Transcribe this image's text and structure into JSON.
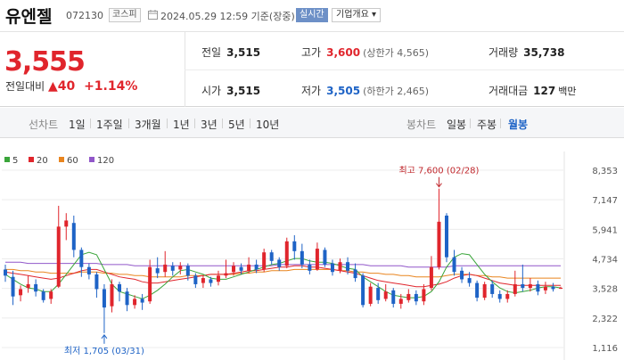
{
  "header": {
    "name": "유엔젤",
    "code": "072130",
    "market": "코스피",
    "datetime": "2024.05.29 12:59 기준(장중)",
    "realtime_label": "실시간",
    "company_label": "기업개요 ▾"
  },
  "summary": {
    "price": "3,555",
    "change_label": "전일대비",
    "change_value": "▲40",
    "change_pct": "+1.14%",
    "cells": {
      "prev_label": "전일",
      "prev_value": "3,515",
      "open_label": "시가",
      "open_value": "3,515",
      "high_label": "고가",
      "high_value": "3,600",
      "high_sub": "(상한가 4,565)",
      "low_label": "저가",
      "low_value": "3,505",
      "low_sub": "(하한가 2,465)",
      "volume_label": "거래량",
      "volume_value": "35,738",
      "amount_label": "거래대금",
      "amount_value": "127",
      "amount_unit": "백만"
    }
  },
  "periods": {
    "line_label": "선차트",
    "line_items": [
      "1일",
      "1주일",
      "3개월",
      "1년",
      "3년",
      "5년",
      "10년"
    ],
    "candle_label": "봉차트",
    "candle_items": [
      "일봉",
      "주봉",
      "월봉"
    ],
    "active": "월봉"
  },
  "colors": {
    "up": "#e0252c",
    "down": "#1e63c6",
    "ma5": "#3aa53a",
    "ma20": "#e0252c",
    "ma60": "#e9851f",
    "ma120": "#9157c9"
  },
  "chart_data": {
    "type": "candlestick",
    "legend": [
      {
        "name": "5",
        "color": "#3aa53a"
      },
      {
        "name": "20",
        "color": "#e0252c"
      },
      {
        "name": "60",
        "color": "#e9851f"
      },
      {
        "name": "120",
        "color": "#9157c9"
      }
    ],
    "y_ticks": [
      8353,
      7147,
      5941,
      4734,
      3528,
      2322,
      1116
    ],
    "ylim": [
      1116,
      8353
    ],
    "annotations": {
      "high": "최고 7,600 (02/28)",
      "low": "최저 1,705 (03/31)"
    },
    "candles": [
      {
        "o": 4300,
        "c": 4050,
        "h": 4500,
        "l": 3800
      },
      {
        "o": 4000,
        "c": 3200,
        "h": 4250,
        "l": 2850
      },
      {
        "o": 3250,
        "c": 3500,
        "h": 3650,
        "l": 3000
      },
      {
        "o": 3550,
        "c": 3700,
        "h": 4050,
        "l": 3350
      },
      {
        "o": 3700,
        "c": 3400,
        "h": 3900,
        "l": 3200
      },
      {
        "o": 3400,
        "c": 3050,
        "h": 3500,
        "l": 2950
      },
      {
        "o": 3100,
        "c": 3400,
        "h": 3500,
        "l": 2900
      },
      {
        "o": 3600,
        "c": 6050,
        "h": 6900,
        "l": 3550
      },
      {
        "o": 6050,
        "c": 6300,
        "h": 6600,
        "l": 5500
      },
      {
        "o": 6200,
        "c": 5100,
        "h": 6500,
        "l": 4800
      },
      {
        "o": 5100,
        "c": 4400,
        "h": 5200,
        "l": 4000
      },
      {
        "o": 4400,
        "c": 4100,
        "h": 4550,
        "l": 3900
      },
      {
        "o": 4100,
        "c": 3500,
        "h": 4200,
        "l": 3150
      },
      {
        "o": 3500,
        "c": 2750,
        "h": 3700,
        "l": 1705
      },
      {
        "o": 2800,
        "c": 3700,
        "h": 3900,
        "l": 2550
      },
      {
        "o": 3700,
        "c": 3400,
        "h": 3800,
        "l": 3000
      },
      {
        "o": 3400,
        "c": 2850,
        "h": 3550,
        "l": 2600
      },
      {
        "o": 2850,
        "c": 3100,
        "h": 3250,
        "l": 2700
      },
      {
        "o": 3100,
        "c": 2950,
        "h": 3300,
        "l": 2650
      },
      {
        "o": 3000,
        "c": 4400,
        "h": 4700,
        "l": 2900
      },
      {
        "o": 4350,
        "c": 4150,
        "h": 4800,
        "l": 3950
      },
      {
        "o": 4200,
        "c": 4500,
        "h": 5050,
        "l": 4000
      },
      {
        "o": 4450,
        "c": 4250,
        "h": 4600,
        "l": 4050
      },
      {
        "o": 4300,
        "c": 4450,
        "h": 4600,
        "l": 4100
      },
      {
        "o": 4450,
        "c": 4050,
        "h": 4550,
        "l": 3850
      },
      {
        "o": 4050,
        "c": 3700,
        "h": 4150,
        "l": 3550
      },
      {
        "o": 3750,
        "c": 3950,
        "h": 4050,
        "l": 3550
      },
      {
        "o": 3900,
        "c": 3750,
        "h": 4000,
        "l": 3600
      },
      {
        "o": 3800,
        "c": 4050,
        "h": 4250,
        "l": 3650
      },
      {
        "o": 4050,
        "c": 4150,
        "h": 4700,
        "l": 3950
      },
      {
        "o": 4200,
        "c": 4450,
        "h": 4600,
        "l": 4050
      },
      {
        "o": 4400,
        "c": 4250,
        "h": 4550,
        "l": 4100
      },
      {
        "o": 4250,
        "c": 4500,
        "h": 4800,
        "l": 4150
      },
      {
        "o": 4500,
        "c": 4300,
        "h": 4700,
        "l": 4150
      },
      {
        "o": 4300,
        "c": 5000,
        "h": 5150,
        "l": 4200
      },
      {
        "o": 5000,
        "c": 4650,
        "h": 5100,
        "l": 4500
      },
      {
        "o": 4700,
        "c": 4400,
        "h": 4800,
        "l": 4250
      },
      {
        "o": 4450,
        "c": 5450,
        "h": 5600,
        "l": 4350
      },
      {
        "o": 5450,
        "c": 5050,
        "h": 5700,
        "l": 4700
      },
      {
        "o": 5050,
        "c": 4500,
        "h": 5350,
        "l": 4350
      },
      {
        "o": 4500,
        "c": 4250,
        "h": 4700,
        "l": 4100
      },
      {
        "o": 4300,
        "c": 5150,
        "h": 5400,
        "l": 4250
      },
      {
        "o": 5100,
        "c": 4500,
        "h": 5200,
        "l": 4400
      },
      {
        "o": 4550,
        "c": 4200,
        "h": 4700,
        "l": 4050
      },
      {
        "o": 4250,
        "c": 4600,
        "h": 4750,
        "l": 4150
      },
      {
        "o": 4600,
        "c": 4250,
        "h": 4800,
        "l": 4100
      },
      {
        "o": 4300,
        "c": 3950,
        "h": 4550,
        "l": 3800
      },
      {
        "o": 4050,
        "c": 2850,
        "h": 4150,
        "l": 2750
      },
      {
        "o": 2900,
        "c": 3600,
        "h": 3750,
        "l": 2800
      },
      {
        "o": 3550,
        "c": 3050,
        "h": 3750,
        "l": 2900
      },
      {
        "o": 3100,
        "c": 3400,
        "h": 3700,
        "l": 3000
      },
      {
        "o": 3450,
        "c": 2900,
        "h": 3550,
        "l": 2750
      },
      {
        "o": 2900,
        "c": 3100,
        "h": 3300,
        "l": 2700
      },
      {
        "o": 3050,
        "c": 3300,
        "h": 3500,
        "l": 2950
      },
      {
        "o": 3300,
        "c": 3000,
        "h": 3450,
        "l": 2850
      },
      {
        "o": 3000,
        "c": 3500,
        "h": 3700,
        "l": 2850
      },
      {
        "o": 3550,
        "c": 4400,
        "h": 4850,
        "l": 3450
      },
      {
        "o": 4400,
        "c": 6250,
        "h": 7600,
        "l": 4300
      },
      {
        "o": 6500,
        "c": 4800,
        "h": 6600,
        "l": 4600
      },
      {
        "o": 4800,
        "c": 4200,
        "h": 5100,
        "l": 4050
      },
      {
        "o": 4250,
        "c": 3900,
        "h": 4400,
        "l": 3750
      },
      {
        "o": 3950,
        "c": 3750,
        "h": 4200,
        "l": 3600
      },
      {
        "o": 3750,
        "c": 3150,
        "h": 3850,
        "l": 3000
      },
      {
        "o": 3150,
        "c": 3700,
        "h": 3800,
        "l": 3050
      },
      {
        "o": 3700,
        "c": 3300,
        "h": 3850,
        "l": 3150
      },
      {
        "o": 3300,
        "c": 3100,
        "h": 3450,
        "l": 2950
      },
      {
        "o": 3100,
        "c": 3300,
        "h": 3450,
        "l": 2950
      },
      {
        "o": 3300,
        "c": 3700,
        "h": 4250,
        "l": 3200
      },
      {
        "o": 3700,
        "c": 3550,
        "h": 4500,
        "l": 3400
      },
      {
        "o": 3550,
        "c": 3700,
        "h": 3950,
        "l": 3400
      },
      {
        "o": 3700,
        "c": 3400,
        "h": 3850,
        "l": 3250
      },
      {
        "o": 3450,
        "c": 3600,
        "h": 3800,
        "l": 3300
      },
      {
        "o": 3600,
        "c": 3500,
        "h": 3750,
        "l": 3400
      },
      {
        "o": 3515,
        "c": 3555,
        "h": 3600,
        "l": 3505
      }
    ],
    "ma5": [
      4100,
      3900,
      3700,
      3550,
      3500,
      3400,
      3400,
      3700,
      4100,
      4500,
      4900,
      5000,
      4900,
      4300,
      3700,
      3400,
      3300,
      3200,
      3100,
      3250,
      3450,
      3700,
      4000,
      4250,
      4300,
      4200,
      4100,
      3950,
      3900,
      3900,
      4000,
      4100,
      4200,
      4300,
      4400,
      4500,
      4550,
      4650,
      4750,
      4750,
      4650,
      4600,
      4600,
      4550,
      4450,
      4350,
      4300,
      4000,
      3800,
      3600,
      3400,
      3250,
      3200,
      3150,
      3150,
      3200,
      3400,
      3800,
      4400,
      4800,
      4950,
      4900,
      4500,
      4100,
      3800,
      3550,
      3400,
      3350,
      3400,
      3450,
      3550,
      3600,
      3600,
      3550
    ],
    "ma20": [
      4200,
      4150,
      4100,
      4050,
      4000,
      3950,
      3900,
      3950,
      4050,
      4150,
      4250,
      4300,
      4300,
      4200,
      4100,
      4000,
      3950,
      3900,
      3800,
      3750,
      3750,
      3800,
      3850,
      3900,
      3950,
      4000,
      4050,
      4100,
      4100,
      4100,
      4150,
      4200,
      4250,
      4250,
      4300,
      4350,
      4400,
      4400,
      4450,
      4450,
      4400,
      4400,
      4350,
      4300,
      4250,
      4200,
      4150,
      4050,
      3950,
      3850,
      3800,
      3750,
      3700,
      3650,
      3600,
      3600,
      3650,
      3700,
      3800,
      3950,
      4050,
      4100,
      4050,
      3950,
      3850,
      3750,
      3700,
      3650,
      3650,
      3650,
      3650,
      3650,
      3650,
      3650
    ],
    "ma60": [
      4300,
      4300,
      4250,
      4250,
      4200,
      4200,
      4150,
      4150,
      4150,
      4150,
      4200,
      4200,
      4200,
      4150,
      4150,
      4100,
      4100,
      4050,
      4050,
      4000,
      4000,
      4000,
      4000,
      4000,
      4050,
      4050,
      4050,
      4100,
      4100,
      4100,
      4100,
      4150,
      4150,
      4200,
      4200,
      4250,
      4250,
      4250,
      4300,
      4300,
      4300,
      4300,
      4300,
      4300,
      4250,
      4250,
      4200,
      4200,
      4150,
      4150,
      4100,
      4100,
      4050,
      4050,
      4000,
      4000,
      4000,
      4000,
      4050,
      4100,
      4100,
      4100,
      4050,
      4050,
      4000,
      4000,
      3950,
      3950,
      3950,
      3950,
      3950,
      3950,
      3950,
      3950
    ],
    "ma120": [
      4600,
      4600,
      4600,
      4550,
      4550,
      4550,
      4550,
      4550,
      4550,
      4550,
      4550,
      4550,
      4550,
      4500,
      4500,
      4500,
      4500,
      4450,
      4450,
      4450,
      4450,
      4450,
      4450,
      4450,
      4450,
      4450,
      4450,
      4450,
      4450,
      4450,
      4450,
      4450,
      4450,
      4450,
      4450,
      4450,
      4500,
      4500,
      4500,
      4500,
      4500,
      4500,
      4500,
      4500,
      4500,
      4500,
      4500,
      4500,
      4450,
      4450,
      4450,
      4450,
      4450,
      4400,
      4400,
      4400,
      4400,
      4400,
      4400,
      4450,
      4450,
      4450,
      4450,
      4450,
      4450,
      4450,
      4450,
      4450,
      4450,
      4450,
      4450,
      4450,
      4450,
      4450
    ]
  }
}
